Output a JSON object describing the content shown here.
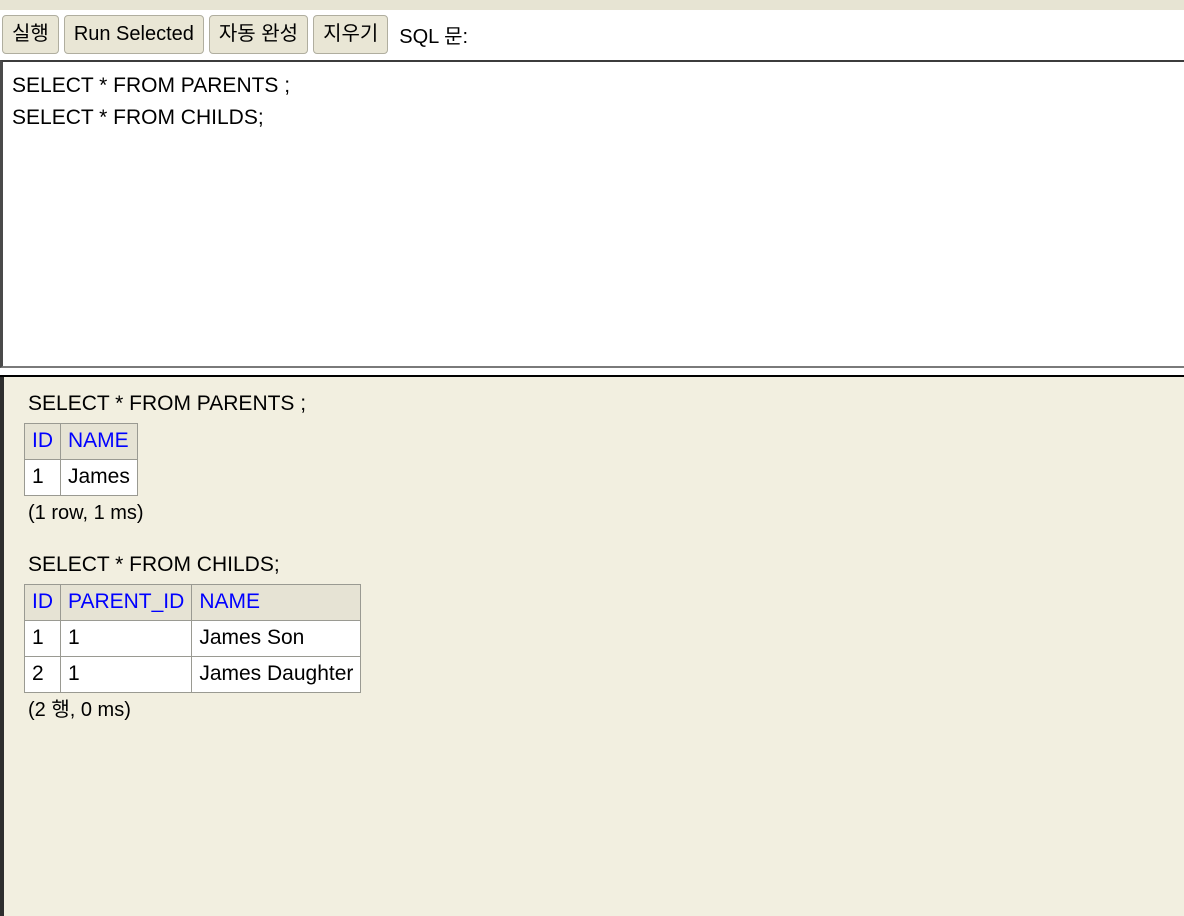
{
  "toolbar": {
    "buttons": [
      {
        "label": "실행",
        "name": "run-button"
      },
      {
        "label": "Run Selected",
        "name": "run-selected-button"
      },
      {
        "label": "자동 완성",
        "name": "auto-complete-button"
      },
      {
        "label": "지우기",
        "name": "clear-button"
      }
    ],
    "sql_label": "SQL 문:"
  },
  "editor": {
    "value": "SELECT * FROM PARENTS ;\nSELECT * FROM CHILDS;",
    "placeholder": ""
  },
  "results": [
    {
      "query": "SELECT * FROM PARENTS ;",
      "columns": [
        "ID",
        "NAME"
      ],
      "rows": [
        [
          "1",
          "James"
        ]
      ],
      "status": "(1 row, 1 ms)"
    },
    {
      "query": "SELECT * FROM CHILDS;",
      "columns": [
        "ID",
        "PARENT_ID",
        "NAME"
      ],
      "rows": [
        [
          "1",
          "1",
          "James Son"
        ],
        [
          "2",
          "1",
          "James Daughter"
        ]
      ],
      "status": "(2 행, 0 ms)"
    }
  ],
  "colors": {
    "toolbar_button_bg": "#e9e6d5",
    "results_bg": "#f2efe0",
    "table_header_bg": "#e6e3d4",
    "table_header_text": "#0000ff",
    "table_border": "#9a9a92",
    "top_strip": "#e7e4d3"
  }
}
